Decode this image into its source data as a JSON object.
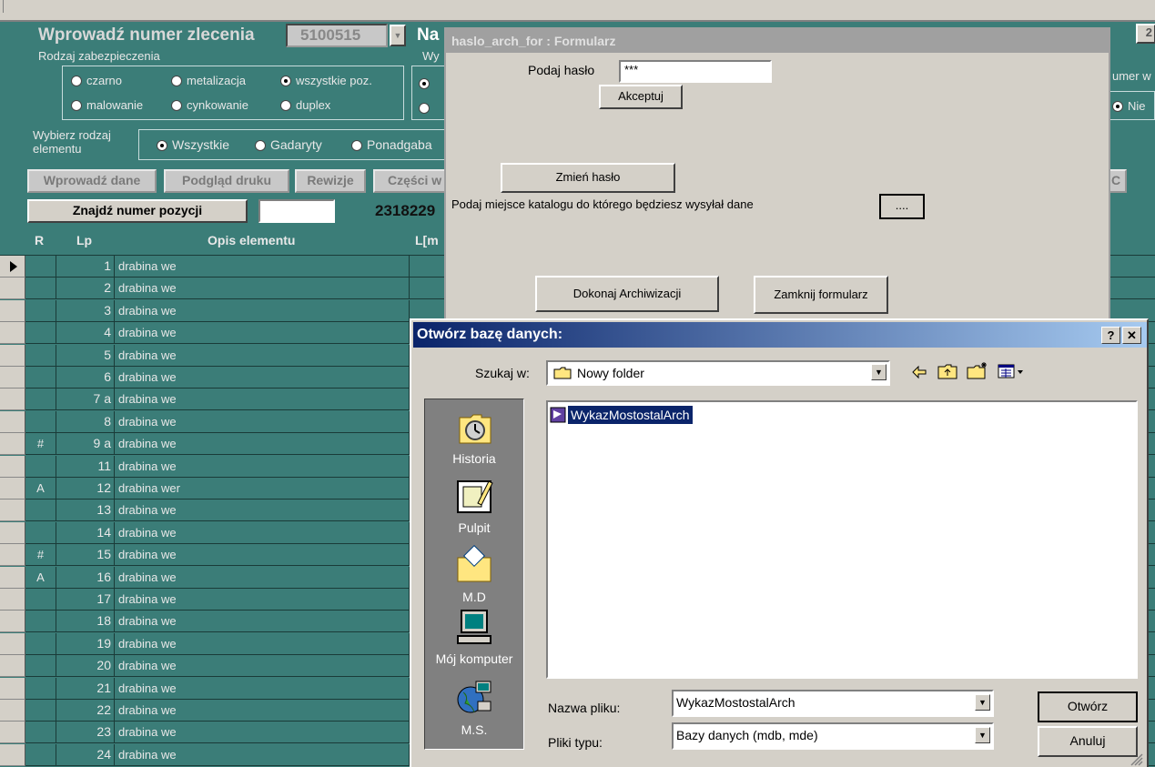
{
  "main": {
    "order_label": "Wprowadź numer zlecenia",
    "order_value": "5100515",
    "na_label": "Na",
    "wy_label": "Wy",
    "protection_label": "Rodzaj zabezpieczenia",
    "protection": [
      {
        "label": "czarno",
        "selected": false
      },
      {
        "label": "metalizacja",
        "selected": false
      },
      {
        "label": "wszystkie poz.",
        "selected": true
      },
      {
        "label": "malowanie",
        "selected": false
      },
      {
        "label": "cynkowanie",
        "selected": false
      },
      {
        "label": "duplex",
        "selected": false
      }
    ],
    "element_type_label": "Wybierz rodzaj elementu",
    "element_types": [
      {
        "label": "Wszystkie",
        "selected": true
      },
      {
        "label": "Gadaryty",
        "selected": false
      },
      {
        "label": "Ponadgaba",
        "selected": false
      }
    ],
    "buttons": {
      "enter_data": "Wprowadź dane",
      "print_preview": "Podgląd druku",
      "revisions": "Rewizje",
      "parts": "Części w",
      "find_position": "Znajdź numer pozycji",
      "right_c": "C"
    },
    "code_value": "2318229",
    "top_right_value": "2",
    "right_label": "umer w",
    "right_radio_label": "Nie",
    "columns": {
      "r": "R",
      "lp": "Lp",
      "desc": "Opis elementu",
      "len": "L[m"
    },
    "rows": [
      {
        "r": "",
        "lp": "1",
        "desc": "drabina we"
      },
      {
        "r": "",
        "lp": "2",
        "desc": "drabina we"
      },
      {
        "r": "",
        "lp": "3",
        "desc": "drabina we"
      },
      {
        "r": "",
        "lp": "4",
        "desc": "drabina we"
      },
      {
        "r": "",
        "lp": "5",
        "desc": "drabina we"
      },
      {
        "r": "",
        "lp": "6",
        "desc": "drabina we"
      },
      {
        "r": "",
        "lp": "7 a",
        "desc": "drabina we"
      },
      {
        "r": "",
        "lp": "8",
        "desc": "drabina we"
      },
      {
        "r": "#",
        "lp": "9 a",
        "desc": "drabina we"
      },
      {
        "r": "",
        "lp": "11",
        "desc": "drabina we"
      },
      {
        "r": "A",
        "lp": "12",
        "desc": "drabina wer"
      },
      {
        "r": "",
        "lp": "13",
        "desc": "drabina we"
      },
      {
        "r": "",
        "lp": "14",
        "desc": "drabina we"
      },
      {
        "r": "#",
        "lp": "15",
        "desc": "drabina we"
      },
      {
        "r": "A",
        "lp": "16",
        "desc": "drabina we"
      },
      {
        "r": "",
        "lp": "17",
        "desc": "drabina we"
      },
      {
        "r": "",
        "lp": "18",
        "desc": "drabina we"
      },
      {
        "r": "",
        "lp": "19",
        "desc": "drabina we"
      },
      {
        "r": "",
        "lp": "20",
        "desc": "drabina we"
      },
      {
        "r": "",
        "lp": "21",
        "desc": "drabina we"
      },
      {
        "r": "",
        "lp": "22",
        "desc": "drabina we"
      },
      {
        "r": "",
        "lp": "23",
        "desc": "drabina we"
      },
      {
        "r": "",
        "lp": "24",
        "desc": "drabina we"
      }
    ]
  },
  "form": {
    "title": "haslo_arch_for : Formularz",
    "password_label": "Podaj hasło",
    "password_value": "***",
    "accept": "Akceptuj",
    "change_password": "Zmień hasło",
    "catalog_label": "Podaj miejsce katalogu do którego będziesz wysyłał dane",
    "browse": "....",
    "archive": "Dokonaj Archiwizacji",
    "close": "Zamknij formularz"
  },
  "dialog": {
    "title": "Otwórz bazę danych:",
    "help": "?",
    "close": "✕",
    "look_in_label": "Szukaj w:",
    "look_in_value": "Nowy folder",
    "places": [
      {
        "label": "Historia",
        "icon": "history-icon"
      },
      {
        "label": "Pulpit",
        "icon": "desktop-icon"
      },
      {
        "label": "M.D",
        "icon": "documents-folder-icon"
      },
      {
        "label": "Mój komputer",
        "icon": "my-computer-icon"
      },
      {
        "label": "M.S.",
        "icon": "network-icon"
      }
    ],
    "file": "WykazMostostalArch",
    "filename_label": "Nazwa pliku:",
    "filename_value": "WykazMostostalArch",
    "filetype_label": "Pliki typu:",
    "filetype_value": "Bazy danych (mdb, mde)",
    "open": "Otwórz",
    "cancel": "Anuluj"
  }
}
